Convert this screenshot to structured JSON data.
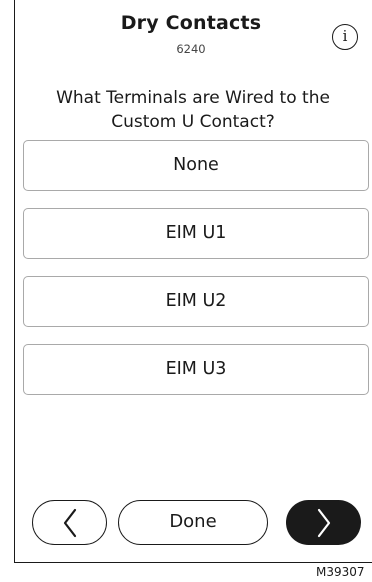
{
  "header": {
    "title": "Dry Contacts",
    "code": "6240",
    "info_icon": "info-icon",
    "info_glyph": "i"
  },
  "question": {
    "line1": "What Terminals are Wired to the",
    "line2": "Custom U Contact?"
  },
  "options": [
    {
      "label": "None"
    },
    {
      "label": "EIM U1"
    },
    {
      "label": "EIM U2"
    },
    {
      "label": "EIM U3"
    }
  ],
  "footer": {
    "back_icon": "chevron-left-icon",
    "done_label": "Done",
    "next_icon": "chevron-right-icon"
  },
  "figure_code": "M39307",
  "colors": {
    "primary": "#1a1a1a",
    "border": "#a9a9a9",
    "background": "#ffffff"
  }
}
